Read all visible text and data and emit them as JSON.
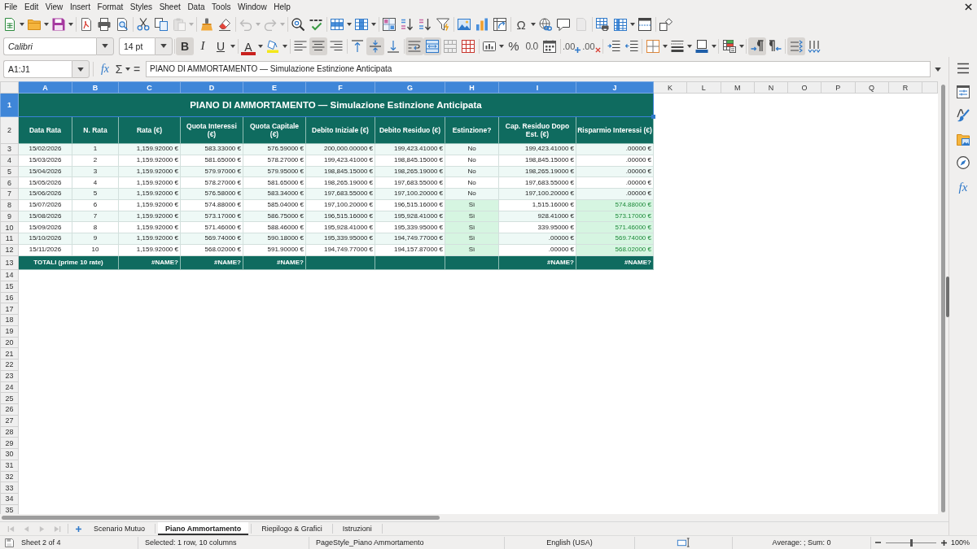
{
  "menu": [
    "File",
    "Edit",
    "View",
    "Insert",
    "Format",
    "Styles",
    "Sheet",
    "Data",
    "Tools",
    "Window",
    "Help"
  ],
  "standard_toolbar": {
    "special_character": "Ω",
    "disabled": {
      "paste": true,
      "undo": true,
      "redo": true,
      "header_footer": true
    }
  },
  "formatting_toolbar": {
    "font_name": "Calibri",
    "font_size": "14 pt",
    "bold": {
      "label": "B",
      "pressed": true
    },
    "italic": {
      "label": "I",
      "pressed": false
    },
    "underline": {
      "label": "U",
      "pressed": false
    },
    "font_color": {
      "label": "A"
    },
    "align_left": {
      "pressed": false
    },
    "align_center": {
      "pressed": true
    },
    "align_right": {
      "pressed": false
    },
    "align_top": {
      "pressed": false
    },
    "align_middle": {
      "pressed": true
    },
    "align_bottom": {
      "pressed": false
    },
    "wrap_text": {
      "pressed": true
    },
    "merge_center": {
      "pressed": true
    },
    "percent": {
      "label": "%"
    },
    "number": {
      "label": "0.0"
    },
    "add_decimal": {
      "label": ".00"
    },
    "delete_decimal": {
      "label": ".00"
    },
    "left_to_right": {
      "pressed": true
    },
    "right_to_left": {
      "pressed": false
    },
    "text_horizontal": {
      "pressed": true
    },
    "text_vertical": {
      "pressed": false
    }
  },
  "formula_bar": {
    "name_box": "A1:J1",
    "function_wizard": "fx",
    "sum": "Σ",
    "equals": "=",
    "content": "PIANO DI AMMORTAMENTO — Simulazione Estinzione Anticipata"
  },
  "sheet": {
    "columns": [
      {
        "label": "A",
        "selected": true
      },
      {
        "label": "B",
        "selected": true
      },
      {
        "label": "C",
        "selected": true
      },
      {
        "label": "D",
        "selected": true
      },
      {
        "label": "E",
        "selected": true
      },
      {
        "label": "F",
        "selected": true
      },
      {
        "label": "G",
        "selected": true
      },
      {
        "label": "H",
        "selected": true
      },
      {
        "label": "I",
        "selected": true
      },
      {
        "label": "J",
        "selected": true
      },
      {
        "label": "K",
        "selected": false
      },
      {
        "label": "L",
        "selected": false
      },
      {
        "label": "M",
        "selected": false
      },
      {
        "label": "N",
        "selected": false
      },
      {
        "label": "O",
        "selected": false
      },
      {
        "label": "P",
        "selected": false
      },
      {
        "label": "Q",
        "selected": false
      },
      {
        "label": "R",
        "selected": false
      }
    ],
    "row_headers": [
      {
        "label": "1",
        "selected": true
      },
      {
        "label": "2",
        "selected": false
      },
      {
        "label": "3",
        "selected": false
      },
      {
        "label": "4",
        "selected": false
      },
      {
        "label": "5",
        "selected": false
      },
      {
        "label": "6",
        "selected": false
      },
      {
        "label": "7",
        "selected": false
      },
      {
        "label": "8",
        "selected": false
      },
      {
        "label": "9",
        "selected": false
      },
      {
        "label": "10",
        "selected": false
      },
      {
        "label": "11",
        "selected": false
      },
      {
        "label": "12",
        "selected": false
      },
      {
        "label": "13",
        "selected": false
      },
      {
        "label": "14",
        "selected": false
      },
      {
        "label": "15",
        "selected": false
      },
      {
        "label": "16",
        "selected": false
      },
      {
        "label": "17",
        "selected": false
      },
      {
        "label": "18",
        "selected": false
      },
      {
        "label": "19",
        "selected": false
      },
      {
        "label": "20",
        "selected": false
      },
      {
        "label": "21",
        "selected": false
      },
      {
        "label": "22",
        "selected": false
      },
      {
        "label": "23",
        "selected": false
      },
      {
        "label": "24",
        "selected": false
      },
      {
        "label": "25",
        "selected": false
      },
      {
        "label": "26",
        "selected": false
      },
      {
        "label": "27",
        "selected": false
      },
      {
        "label": "28",
        "selected": false
      },
      {
        "label": "29",
        "selected": false
      },
      {
        "label": "30",
        "selected": false
      },
      {
        "label": "31",
        "selected": false
      },
      {
        "label": "32",
        "selected": false
      },
      {
        "label": "33",
        "selected": false
      },
      {
        "label": "34",
        "selected": false
      },
      {
        "label": "35",
        "selected": false
      }
    ],
    "title": "PIANO DI AMMORTAMENTO — Simulazione Estinzione Anticipata",
    "headers": [
      "Data Rata",
      "N. Rata",
      "Rata (€)",
      "Quota Interessi (€)",
      "Quota Capitale (€)",
      "Debito Iniziale (€)",
      "Debito Residuo (€)",
      "Estinzione?",
      "Cap. Residuo Dopo Est. (€)",
      "Risparmio Interessi (€)"
    ],
    "data": [
      {
        "cells": [
          "15/02/2026",
          "1",
          "1,159.92000 €",
          "583.33000 €",
          "576.59000 €",
          "200,000.00000 €",
          "199,423.41000 €",
          "No",
          "199,423.41000 €",
          ".00000 €"
        ],
        "early_payoff": false
      },
      {
        "cells": [
          "15/03/2026",
          "2",
          "1,159.92000 €",
          "581.65000 €",
          "578.27000 €",
          "199,423.41000 €",
          "198,845.15000 €",
          "No",
          "198,845.15000 €",
          ".00000 €"
        ],
        "early_payoff": false
      },
      {
        "cells": [
          "15/04/2026",
          "3",
          "1,159.92000 €",
          "579.97000 €",
          "579.95000 €",
          "198,845.15000 €",
          "198,265.19000 €",
          "No",
          "198,265.19000 €",
          ".00000 €"
        ],
        "early_payoff": false
      },
      {
        "cells": [
          "15/05/2026",
          "4",
          "1,159.92000 €",
          "578.27000 €",
          "581.65000 €",
          "198,265.19000 €",
          "197,683.55000 €",
          "No",
          "197,683.55000 €",
          ".00000 €"
        ],
        "early_payoff": false
      },
      {
        "cells": [
          "15/06/2026",
          "5",
          "1,159.92000 €",
          "576.58000 €",
          "583.34000 €",
          "197,683.55000 €",
          "197,100.20000 €",
          "No",
          "197,100.20000 €",
          ".00000 €"
        ],
        "early_payoff": false
      },
      {
        "cells": [
          "15/07/2026",
          "6",
          "1,159.92000 €",
          "574.88000 €",
          "585.04000 €",
          "197,100.20000 €",
          "196,515.16000 €",
          "Sì",
          "1,515.16000 €",
          "574.88000 €"
        ],
        "early_payoff": true
      },
      {
        "cells": [
          "15/08/2026",
          "7",
          "1,159.92000 €",
          "573.17000 €",
          "586.75000 €",
          "196,515.16000 €",
          "195,928.41000 €",
          "Sì",
          "928.41000 €",
          "573.17000 €"
        ],
        "early_payoff": true
      },
      {
        "cells": [
          "15/09/2026",
          "8",
          "1,159.92000 €",
          "571.46000 €",
          "588.46000 €",
          "195,928.41000 €",
          "195,339.95000 €",
          "Sì",
          "339.95000 €",
          "571.46000 €"
        ],
        "early_payoff": true
      },
      {
        "cells": [
          "15/10/2026",
          "9",
          "1,159.92000 €",
          "569.74000 €",
          "590.18000 €",
          "195,339.95000 €",
          "194,749.77000 €",
          "Sì",
          ".00000 €",
          "569.74000 €"
        ],
        "early_payoff": true
      },
      {
        "cells": [
          "15/11/2026",
          "10",
          "1,159.92000 €",
          "568.02000 €",
          "591.90000 €",
          "194,749.77000 €",
          "194,157.87000 €",
          "Sì",
          ".00000 €",
          "568.02000 €"
        ],
        "early_payoff": true
      }
    ],
    "totals": {
      "label": "TOTALI (prime 10 rate)",
      "rata": "#NAME?",
      "quota_interessi": "#NAME?",
      "quota_capitale": "#NAME?",
      "cap_residuo": "#NAME?",
      "risparmio_interessi": "#NAME?"
    }
  },
  "sidebar": {
    "functions": "fx"
  },
  "sheet_tabs_bar": {
    "navigation_disabled": true,
    "tabs": [
      {
        "label": "Scenario Mutuo",
        "selected": false
      },
      {
        "label": "Piano Ammortamento",
        "selected": true
      },
      {
        "label": "Riepilogo & Grafici",
        "selected": false
      },
      {
        "label": "Istruzioni",
        "selected": false
      }
    ]
  },
  "status_bar": {
    "sheet": "Sheet 2 of 4",
    "selection": "Selected: 1 row, 10 columns",
    "page_style": "PageStyle_Piano Ammortamento",
    "language": "English (USA)",
    "summary": "Average: ; Sum: 0",
    "zoom": {
      "level": 0.5,
      "reading": "100%"
    }
  }
}
